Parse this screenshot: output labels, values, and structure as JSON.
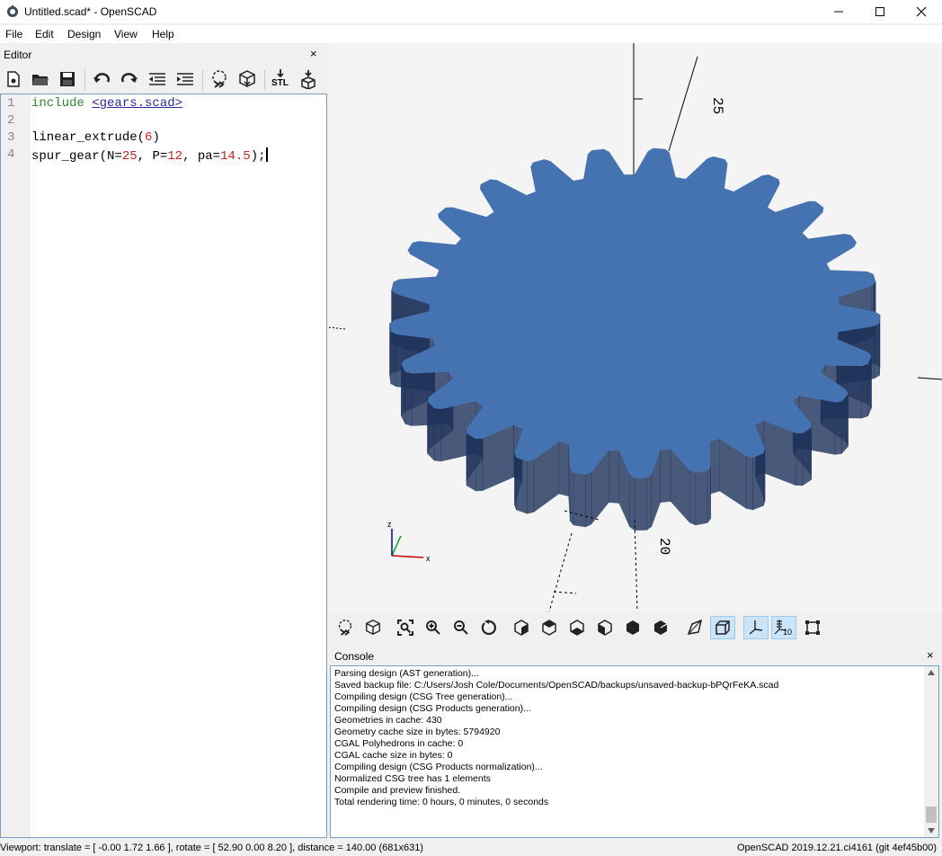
{
  "window": {
    "title": "Untitled.scad* - OpenSCAD",
    "minimize_icon": "minimize-icon",
    "maximize_icon": "maximize-icon",
    "close_icon": "close-icon"
  },
  "menu": [
    "File",
    "Edit",
    "Design",
    "View",
    "Help"
  ],
  "editor": {
    "title": "Editor",
    "close_label": "×",
    "toolbar_icons": [
      "new-file-icon",
      "open-file-icon",
      "save-icon",
      "undo-icon",
      "redo-icon",
      "unindent-icon",
      "indent-icon",
      "preview-icon",
      "render-icon",
      "export-stl-icon",
      "send-to-printer-icon"
    ],
    "stl_label": "STL",
    "line_numbers": [
      "1",
      "2",
      "3",
      "4"
    ],
    "code": {
      "line1_kw": "include",
      "line1_str": "<gears.scad>",
      "line3_fn": "linear_extrude(",
      "line3_num": "6",
      "line3_end": ")",
      "line4_a": "spur_gear(N=",
      "line4_n1": "25",
      "line4_b": ", P=",
      "line4_n2": "12",
      "line4_c": ", pa=",
      "line4_n3": "14.5",
      "line4_d": ");"
    }
  },
  "viewport": {
    "gear_color": "#4572b0",
    "axis_labels": {
      "z": "z",
      "y": "y",
      "x": "x"
    },
    "ruler_labels": [
      "25",
      "20",
      "20"
    ]
  },
  "view_toolbar_icons": [
    "preview-icon",
    "render-icon",
    "view-all-icon",
    "zoom-in-icon",
    "zoom-out-icon",
    "reset-view-icon",
    "view-right-icon",
    "view-top-icon",
    "view-bottom-icon",
    "view-left-icon",
    "view-front-icon",
    "view-back-icon",
    "perspective-icon",
    "orthogonal-icon",
    "show-axes-icon",
    "show-scale-markers-icon",
    "show-edges-icon"
  ],
  "view_toolbar_scale_label": "10",
  "console": {
    "title": "Console",
    "close_label": "×",
    "lines": [
      "Parsing design (AST generation)...",
      "Saved backup file: C:/Users/Josh Cole/Documents/OpenSCAD/backups/unsaved-backup-bPQrFeKA.scad",
      "Compiling design (CSG Tree generation)...",
      "Compiling design (CSG Products generation)...",
      "Geometries in cache: 430",
      "Geometry cache size in bytes: 5794920",
      "CGAL Polyhedrons in cache: 0",
      "CGAL cache size in bytes: 0",
      "Compiling design (CSG Products normalization)...",
      "Normalized CSG tree has 1 elements",
      "Compile and preview finished.",
      "Total rendering time: 0 hours, 0 minutes, 0 seconds"
    ]
  },
  "status": {
    "left": "Viewport: translate = [ -0.00 1.72 1.66 ], rotate = [ 52.90 0.00 8.20 ], distance = 140.00 (681x631)",
    "right": "OpenSCAD 2019.12.21.ci4161 (git 4ef45b00)"
  }
}
